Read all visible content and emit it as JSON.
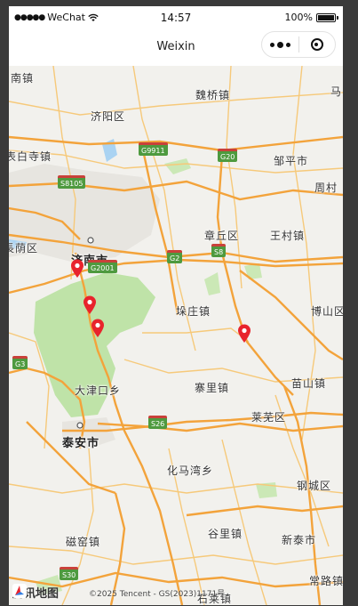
{
  "status_bar": {
    "carrier": "WeChat",
    "time": "14:57",
    "battery": "100%"
  },
  "nav": {
    "title": "Weixin"
  },
  "map": {
    "places": [
      {
        "id": "nanzhen",
        "text": "南镇"
      },
      {
        "id": "weiqiao",
        "text": "魏桥镇"
      },
      {
        "id": "ma",
        "text": "马"
      },
      {
        "id": "jiyang",
        "text": "济阳区"
      },
      {
        "id": "baisi",
        "text": "表白寺镇"
      },
      {
        "id": "zouping",
        "text": "邹平市"
      },
      {
        "id": "zhoucun",
        "text": "周村"
      },
      {
        "id": "zhangqiu",
        "text": "章丘区"
      },
      {
        "id": "wangcun",
        "text": "王村镇"
      },
      {
        "id": "changqing",
        "text": "長荫区"
      },
      {
        "id": "jinan",
        "text": "济南市"
      },
      {
        "id": "duozhuang",
        "text": "垛庄镇"
      },
      {
        "id": "boshan",
        "text": "博山区"
      },
      {
        "id": "dajinkou",
        "text": "大津口乡"
      },
      {
        "id": "zhaili",
        "text": "寨里镇"
      },
      {
        "id": "miaoshan",
        "text": "苗山镇"
      },
      {
        "id": "laiwu",
        "text": "莱芜区"
      },
      {
        "id": "taian",
        "text": "泰安市"
      },
      {
        "id": "huamawan",
        "text": "化马湾乡"
      },
      {
        "id": "gangcheng",
        "text": "钢城区"
      },
      {
        "id": "guli",
        "text": "谷里镇"
      },
      {
        "id": "ciyao",
        "text": "磁窑镇"
      },
      {
        "id": "xintai",
        "text": "新泰市"
      },
      {
        "id": "changlu",
        "text": "常路镇"
      },
      {
        "id": "shilai",
        "text": "石莱镇"
      }
    ],
    "highways": [
      "G9911",
      "G20",
      "S8105",
      "G2001",
      "G2",
      "S8",
      "G3",
      "S26",
      "S30"
    ],
    "markers": [
      "marker-1",
      "marker-2",
      "marker-3",
      "marker-4"
    ],
    "logo_text": "腾讯地图",
    "copyright": "©2025 Tencent - GS(2023)1171号"
  },
  "colors": {
    "road_major": "#f3a33b",
    "road_minor": "#f6c97a",
    "park": "#bfe3a8",
    "water": "#aad3f2",
    "marker": "#e8232c",
    "shield_bg": "#4e9a3f",
    "shield_top": "#c9413a"
  }
}
